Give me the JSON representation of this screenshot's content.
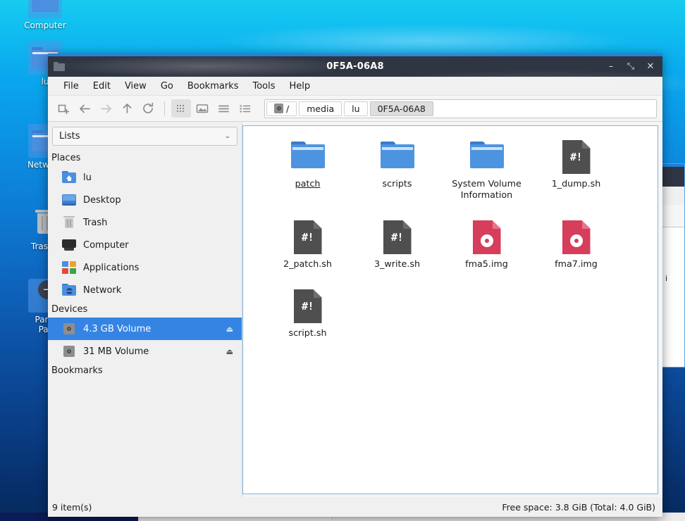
{
  "desktop": {
    "icons": [
      {
        "label": "Computer",
        "icon": "computer-icon"
      },
      {
        "label": "lu",
        "icon": "home-folder-icon"
      },
      {
        "label": "Network",
        "icon": "network-folder-icon"
      },
      {
        "label": "Trash (",
        "icon": "trash-icon"
      },
      {
        "label": "Pana\nPat",
        "icon": "shortcut-arrow-icon"
      }
    ]
  },
  "window": {
    "title": "0F5A-06A8",
    "icon": "folder-icon",
    "controls": {
      "minimize": "–",
      "maximize": "⤡",
      "close": "✕"
    }
  },
  "menubar": {
    "items": [
      "File",
      "Edit",
      "View",
      "Go",
      "Bookmarks",
      "Tools",
      "Help"
    ]
  },
  "toolbar": {
    "buttons": [
      {
        "name": "new-tab-icon",
        "active": false
      },
      {
        "name": "back-icon",
        "active": false
      },
      {
        "name": "forward-icon",
        "active": false
      },
      {
        "name": "up-icon",
        "active": false
      },
      {
        "name": "reload-icon",
        "active": false
      }
    ],
    "view_modes": [
      {
        "name": "icon-view-icon",
        "active": true
      },
      {
        "name": "thumbnail-view-icon",
        "active": false
      },
      {
        "name": "compact-list-view-icon",
        "active": false
      },
      {
        "name": "detailed-list-view-icon",
        "active": false
      }
    ]
  },
  "breadcrumbs": {
    "items": [
      {
        "label": "/",
        "icon": "disk-icon",
        "current": false
      },
      {
        "label": "media",
        "icon": "",
        "current": false
      },
      {
        "label": "lu",
        "icon": "",
        "current": false
      },
      {
        "label": "0F5A-06A8",
        "icon": "",
        "current": true
      }
    ]
  },
  "sidebar": {
    "selector": {
      "value": "Lists",
      "chevron": "⌄"
    },
    "sections": [
      {
        "heading": "Places",
        "items": [
          {
            "label": "lu",
            "icon": "home-folder-icon",
            "selected": false,
            "eject": false
          },
          {
            "label": "Desktop",
            "icon": "desktop-icon",
            "selected": false,
            "eject": false
          },
          {
            "label": "Trash",
            "icon": "trash-icon",
            "selected": false,
            "eject": false
          },
          {
            "label": "Computer",
            "icon": "computer-icon",
            "selected": false,
            "eject": false
          },
          {
            "label": "Applications",
            "icon": "applications-icon",
            "selected": false,
            "eject": false
          },
          {
            "label": "Network",
            "icon": "network-folder-icon",
            "selected": false,
            "eject": false
          }
        ]
      },
      {
        "heading": "Devices",
        "items": [
          {
            "label": "4.3 GB Volume",
            "icon": "volume-icon",
            "selected": true,
            "eject": true
          },
          {
            "label": "31 MB Volume",
            "icon": "volume-icon",
            "selected": false,
            "eject": true
          }
        ]
      },
      {
        "heading": "Bookmarks",
        "items": []
      }
    ],
    "eject_glyph": "⏏"
  },
  "files": {
    "items": [
      {
        "name": "patch",
        "type": "folder",
        "badge": "",
        "hover": true
      },
      {
        "name": "scripts",
        "type": "folder",
        "badge": "",
        "hover": false
      },
      {
        "name": "System Volume Information",
        "type": "folder",
        "badge": "",
        "hover": false
      },
      {
        "name": "1_dump.sh",
        "type": "script",
        "badge": "#!",
        "hover": false
      },
      {
        "name": "2_patch.sh",
        "type": "script",
        "badge": "#!",
        "hover": false
      },
      {
        "name": "3_write.sh",
        "type": "script",
        "badge": "#!",
        "hover": false
      },
      {
        "name": "fma5.img",
        "type": "disc-image",
        "badge": "",
        "hover": false
      },
      {
        "name": "fma7.img",
        "type": "disc-image",
        "badge": "",
        "hover": false
      },
      {
        "name": "script.sh",
        "type": "script",
        "badge": "#!",
        "hover": false
      }
    ]
  },
  "statusbar": {
    "item_count": "9 item(s)",
    "free_space": "Free space: 3.8 GiB (Total: 4.0 GiB)"
  },
  "colors": {
    "accent": "#2b7fd4",
    "selection": "#3584e4",
    "titlebar": "#2f3542",
    "folder": "#4d94e0",
    "script_file": "#4f4f4f",
    "disc_image": "#d63e5c",
    "view_border": "#7fb5e0"
  }
}
